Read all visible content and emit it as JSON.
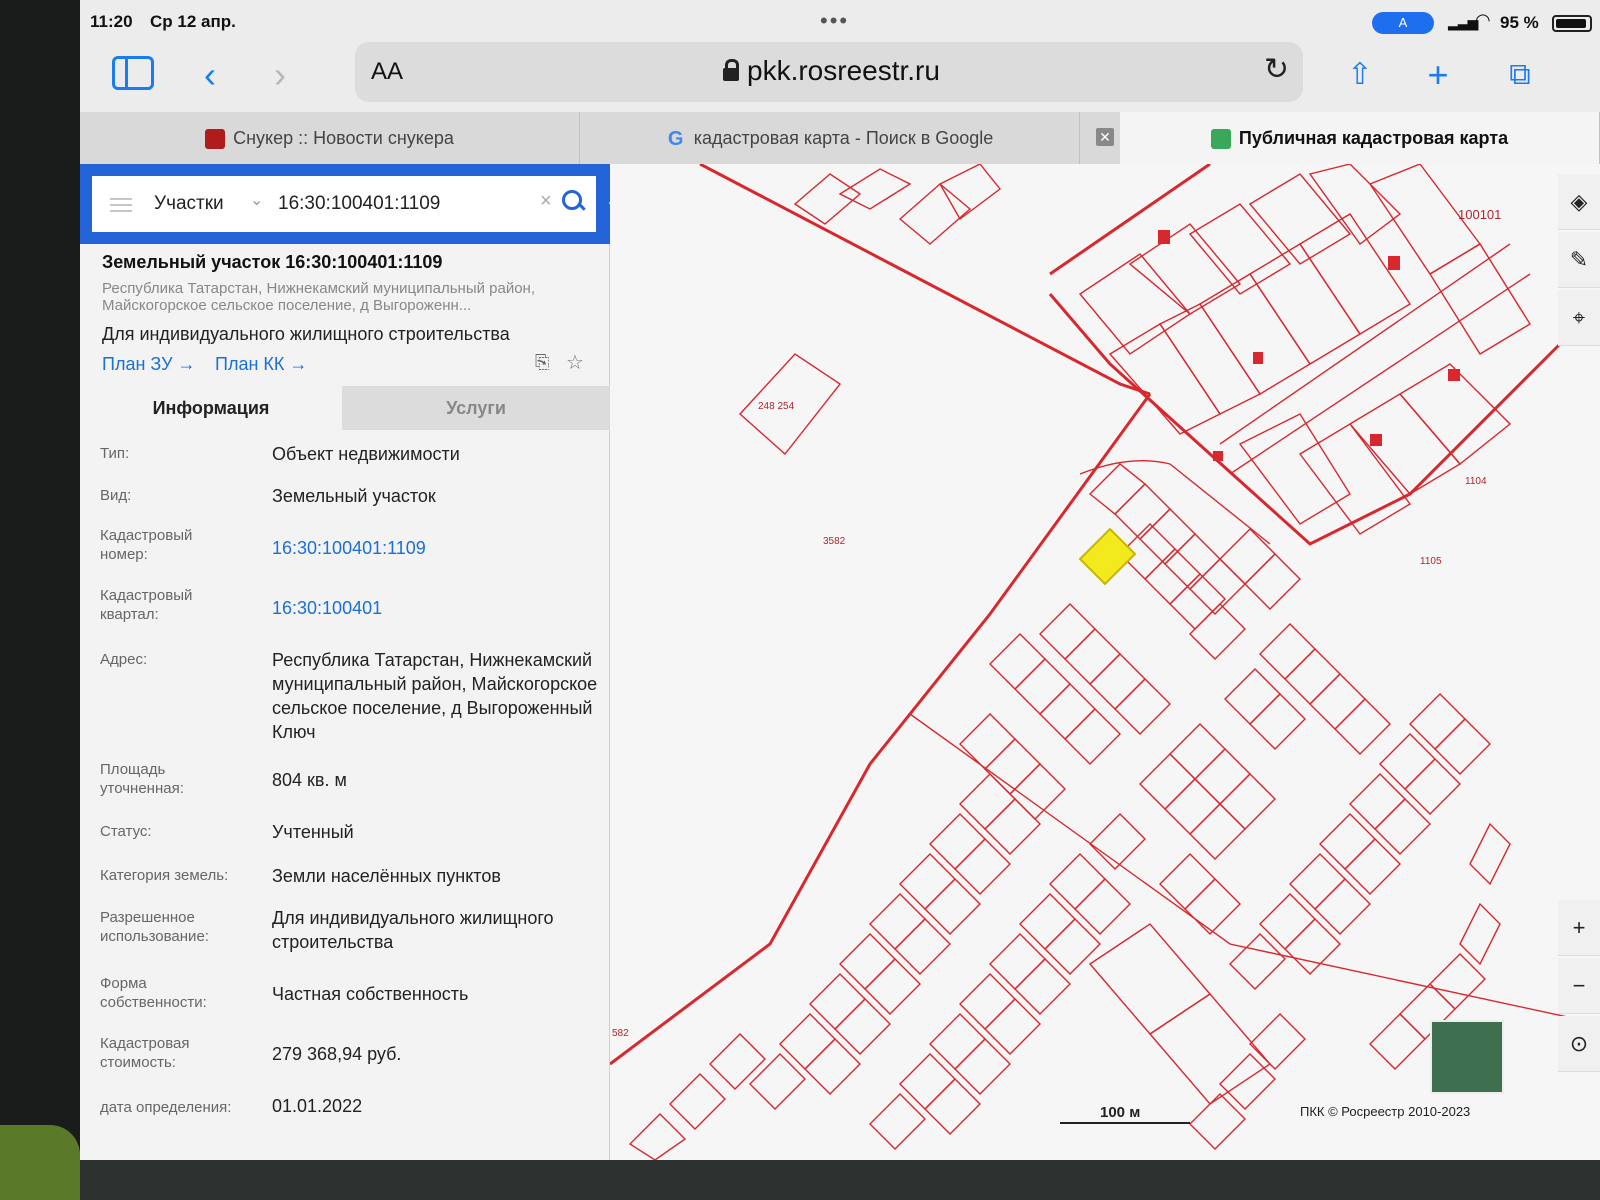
{
  "status": {
    "time": "11:20",
    "date": "Ср 12 апр.",
    "focus_badge": "A",
    "battery": "95 %"
  },
  "toolbar": {
    "reader_label": "AA",
    "url": "pkk.rosreestr.ru"
  },
  "tabs": [
    {
      "label": "Снукер :: Новости снукера",
      "active": false
    },
    {
      "label": "кадастровая карта - Поиск в Google",
      "active": false
    },
    {
      "label": "Публичная кадастровая карта",
      "active": true
    }
  ],
  "search": {
    "type": "Участки",
    "value": "16:30:100401:1109"
  },
  "parcel": {
    "title": "Земельный участок 16:30:100401:1109",
    "address_short": "Республика Татарстан, Нижнекамский муниципальный район, Майскогорское сельское поселение, д Выгороженн...",
    "use": "Для индивидуального жилищного строительства",
    "plan_zu": "План ЗУ",
    "plan_kk": "План КК"
  },
  "info_tabs": {
    "info": "Информация",
    "services": "Услуги"
  },
  "info": [
    {
      "label": "Тип:",
      "value": "Объект недвижимости"
    },
    {
      "label": "Вид:",
      "value": "Земельный участок"
    },
    {
      "label": "Кадастровый номер:",
      "value": "16:30:100401:1109"
    },
    {
      "label": "Кадастровый квартал:",
      "value": "16:30:100401"
    },
    {
      "label": "Адрес:",
      "value": "Республика Татарстан, Нижнекамский муниципальный район, Майскогорское сельское поселение, д Выгороженный Ключ"
    },
    {
      "label": "Площадь уточненная:",
      "value": "804 кв. м"
    },
    {
      "label": "Статус:",
      "value": "Учтенный"
    },
    {
      "label": "Категория земель:",
      "value": "Земли населённых пунктов"
    },
    {
      "label": "Разрешенное использование:",
      "value": "Для индивидуального жилищного строительства"
    },
    {
      "label": "Форма собственности:",
      "value": "Частная собственность"
    },
    {
      "label": "Кадастровая стоимость:",
      "value": "279 368,94 руб."
    },
    {
      "label": "дата определения:",
      "value": "01.01.2022"
    }
  ],
  "map": {
    "quarter_label": "100101",
    "parcel_label_a": "248 254",
    "parcel_label_b": "3582",
    "parcel_label_c": "1104",
    "parcel_label_d": "1105",
    "parcel_label_e": "582",
    "scale": "100 м",
    "copyright": "ПКК © Росреестр 2010-2023",
    "boundary_color": "#d9272e",
    "selected_color": "#f2ea1c"
  }
}
